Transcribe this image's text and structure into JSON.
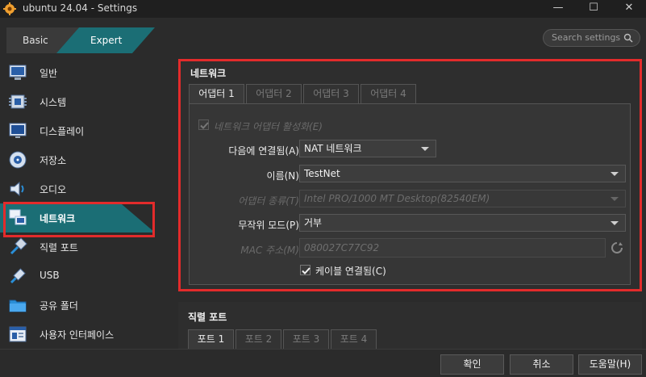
{
  "window": {
    "title": "ubuntu 24.04 - Settings",
    "min": "—",
    "max": "☐",
    "close": "✕"
  },
  "mode": {
    "basic": "Basic",
    "expert": "Expert"
  },
  "search": {
    "placeholder": "Search settings"
  },
  "sidebar": {
    "items": [
      {
        "label": "일반",
        "icon": "monitor-icon"
      },
      {
        "label": "시스템",
        "icon": "chip-icon"
      },
      {
        "label": "디스플레이",
        "icon": "display-icon"
      },
      {
        "label": "저장소",
        "icon": "disk-icon"
      },
      {
        "label": "오디오",
        "icon": "speaker-icon"
      },
      {
        "label": "네트워크",
        "icon": "network-icon"
      },
      {
        "label": "직렬 포트",
        "icon": "serial-icon"
      },
      {
        "label": "USB",
        "icon": "usb-icon"
      },
      {
        "label": "공유 폴더",
        "icon": "folder-icon"
      },
      {
        "label": "사용자 인터페이스",
        "icon": "ui-icon"
      }
    ],
    "selected": "네트워크"
  },
  "network": {
    "title": "네트워크",
    "tabs": [
      {
        "label": "어댑터 1",
        "active": true
      },
      {
        "label": "어댑터 2",
        "active": false
      },
      {
        "label": "어댑터 3",
        "active": false
      },
      {
        "label": "어댑터 4",
        "active": false
      }
    ],
    "enable_label": "네트워크 어댑터 활성화(E)",
    "attached_label": "다음에 연결됨(A):",
    "attached_value": "NAT 네트워크",
    "name_label": "이름(N):",
    "name_value": "TestNet",
    "adapter_type_label": "어댑터 종류(T):",
    "adapter_type_value": "Intel PRO/1000 MT Desktop(82540EM)",
    "promisc_label": "무작위 모드(P):",
    "promisc_value": "거부",
    "mac_label": "MAC 주소(M):",
    "mac_value": "080027C77C92",
    "cable_label": "케이블 연결됨(C)"
  },
  "serial": {
    "title": "직렬 포트",
    "tabs": [
      {
        "label": "포트 1",
        "active": true
      },
      {
        "label": "포트 2",
        "active": false
      },
      {
        "label": "포트 3",
        "active": false
      },
      {
        "label": "포트 4",
        "active": false
      }
    ]
  },
  "buttons": {
    "ok": "확인",
    "cancel": "취소",
    "help": "도움말(H)"
  },
  "colors": {
    "accent": "#1b6e75",
    "highlight_border": "#e32b2b"
  }
}
